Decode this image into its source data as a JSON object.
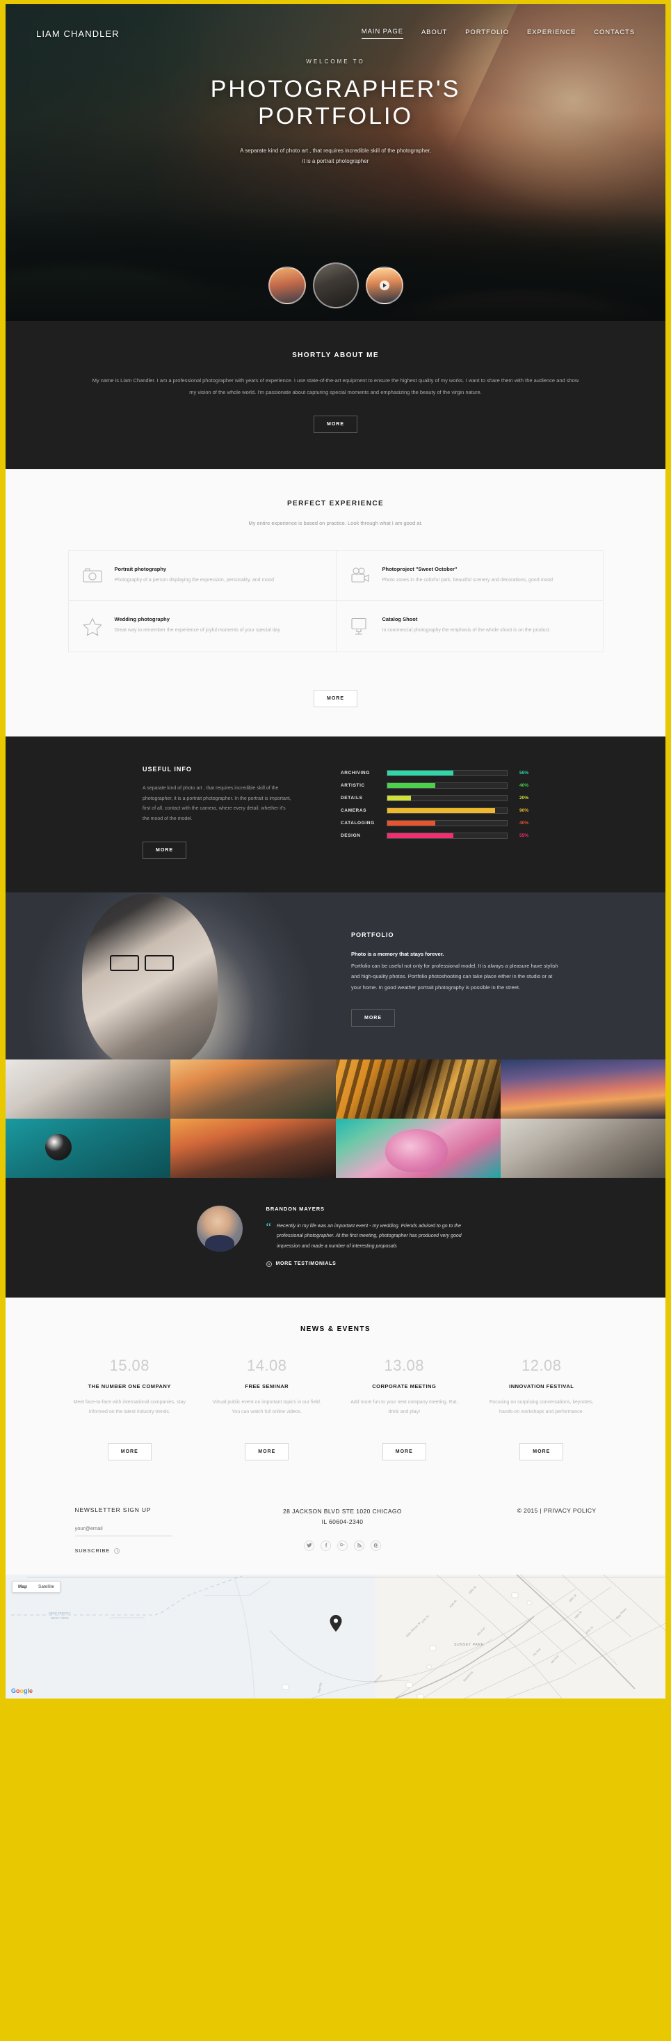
{
  "header": {
    "brand": "LIAM CHANDLER",
    "nav": [
      {
        "label": "MAIN PAGE",
        "active": true
      },
      {
        "label": "ABOUT",
        "active": false
      },
      {
        "label": "PORTFOLIO",
        "active": false
      },
      {
        "label": "EXPERIENCE",
        "active": false
      },
      {
        "label": "CONTACTS",
        "active": false
      }
    ]
  },
  "hero": {
    "welcome": "WELCOME TO",
    "title_line1": "PHOTOGRAPHER'S",
    "title_line2": "PORTFOLIO",
    "sub_line1": "A separate kind of photo art , that requires incredible skill of the photographer,",
    "sub_line2": "it is a portrait photographer"
  },
  "about": {
    "title": "SHORTLY ABOUT ME",
    "text": "My name is Liam Chandler. I am a professional photographer with years of experience. I use state-of-the-art equipment to ensure the highest quality of my works. I want to share them with the audience and show my vision of the whole world. I'm passionate about capturing special moments and emphasizing the beauty of the virgin nature.",
    "button": "MORE"
  },
  "experience": {
    "title": "PERFECT EXPERIENCE",
    "subtitle": "My entire experience is based on practice. Look through what I am good at.",
    "button": "MORE",
    "cards": [
      {
        "icon": "camera-icon",
        "title": "Portrait photography",
        "desc": "Photography of a person displaying the expression, personality, and mood"
      },
      {
        "icon": "video-camera-icon",
        "title": "Photoproject \"Sweet October\"",
        "desc": "Photo zones in the colorful park, beautiful scenery and decorations, good mood"
      },
      {
        "icon": "star-icon",
        "title": "Wedding photography",
        "desc": "Great way to remember the experience of joyful moments of your special day"
      },
      {
        "icon": "monitor-icon",
        "title": "Catalog Shoot",
        "desc": "In commercial photography the emphasis of the whole shoot is on the product."
      }
    ]
  },
  "useful": {
    "title": "USEFUL INFO",
    "text": "A separate kind of photo art , that requires incredible skill of the photographer, it is a portrait photographer. In the portrait is important, first of all, contact with the camera, where every detail, whether it's the mood of the model.",
    "button": "MORE",
    "skills": [
      {
        "name": "ARCHIVING",
        "value": 55,
        "label": "55%",
        "color": "#2fd6a8"
      },
      {
        "name": "ARTISTIC",
        "value": 40,
        "label": "40%",
        "color": "#4bd14b"
      },
      {
        "name": "DETAILS",
        "value": 20,
        "label": "20%",
        "color": "#cfe03a"
      },
      {
        "name": "CAMERAS",
        "value": 90,
        "label": "90%",
        "color": "#efb92d"
      },
      {
        "name": "CATALOGING",
        "value": 40,
        "label": "40%",
        "color": "#e8552d"
      },
      {
        "name": "DESIGN",
        "value": 55,
        "label": "55%",
        "color": "#ef2f70"
      }
    ]
  },
  "portfolio": {
    "title": "PORTFOLIO",
    "lead": "Photo is a memory that stays forever.",
    "text": "Portfolio can be useful not only for professional model. It is always a pleasure have stylish and high-quality photos. Portfolio photoshooting can take place either in the studio or at your home. In good weather portrait photography is possible in the street.",
    "button": "MORE"
  },
  "gallery": [
    {
      "name": "gallery-photo-model"
    },
    {
      "name": "gallery-photo-palm"
    },
    {
      "name": "gallery-photo-tiger"
    },
    {
      "name": "gallery-photo-lighthouse"
    },
    {
      "name": "gallery-photo-billiard"
    },
    {
      "name": "gallery-photo-sunset-rocks"
    },
    {
      "name": "gallery-photo-tulips"
    },
    {
      "name": "gallery-photo-portrait-man"
    }
  ],
  "testimonial": {
    "name": "BRANDON MAYERS",
    "quote_mark": "“",
    "quote": "Recently in my life was an important event - my wedding. Friends advised to go to the professional photographer. At the first meeting, photographer has produced very good impression and made a number of interesting proposals",
    "more": "MORE TESTIMONIALS"
  },
  "news": {
    "title": "NEWS & EVENTS",
    "items": [
      {
        "date": "15.08",
        "title": "THE NUMBER ONE COMPANY",
        "desc": "Meet face-to-face with international companies, stay informed on the latest industry trends.",
        "button": "MORE"
      },
      {
        "date": "14.08",
        "title": "FREE SEMINAR",
        "desc": "Virtual public event on important topics in our field. You can watch full online videos.",
        "button": "MORE"
      },
      {
        "date": "13.08",
        "title": "CORPORATE MEETING",
        "desc": "Add more fun to your next company meeting. Eat, drink and play!",
        "button": "MORE"
      },
      {
        "date": "12.08",
        "title": "INNOVATION FESTIVAL",
        "desc": "Focusing on surprising conversations, keynotes, hands-on workshops and performance.",
        "button": "MORE"
      }
    ]
  },
  "footer": {
    "newsletter_title": "NEWSLETTER SIGN UP",
    "email_placeholder": "your@email",
    "email_value": "",
    "subscribe": "SUBSCRIBE",
    "address_line1": "28 JACKSON BLVD STE 1020 CHICAGO",
    "address_line2": "IL 60604-2340",
    "copyright": "© 2015 | PRIVACY POLICY",
    "socials": [
      {
        "name": "twitter-icon",
        "glyph": "ᴛ"
      },
      {
        "name": "facebook-icon",
        "glyph": "f"
      },
      {
        "name": "google-plus-icon",
        "glyph": "g+"
      },
      {
        "name": "rss-icon",
        "glyph": "≈"
      },
      {
        "name": "pinterest-icon",
        "glyph": "Ⓟ"
      }
    ]
  },
  "map": {
    "btn_map": "Map",
    "btn_satellite": "Satellite",
    "label_state_1": "NEW JERSEY",
    "label_state_2": "NEW YORK",
    "label_park": "SUNSET PARK",
    "logo": [
      "G",
      "o",
      "o",
      "g",
      "l",
      "e"
    ]
  }
}
